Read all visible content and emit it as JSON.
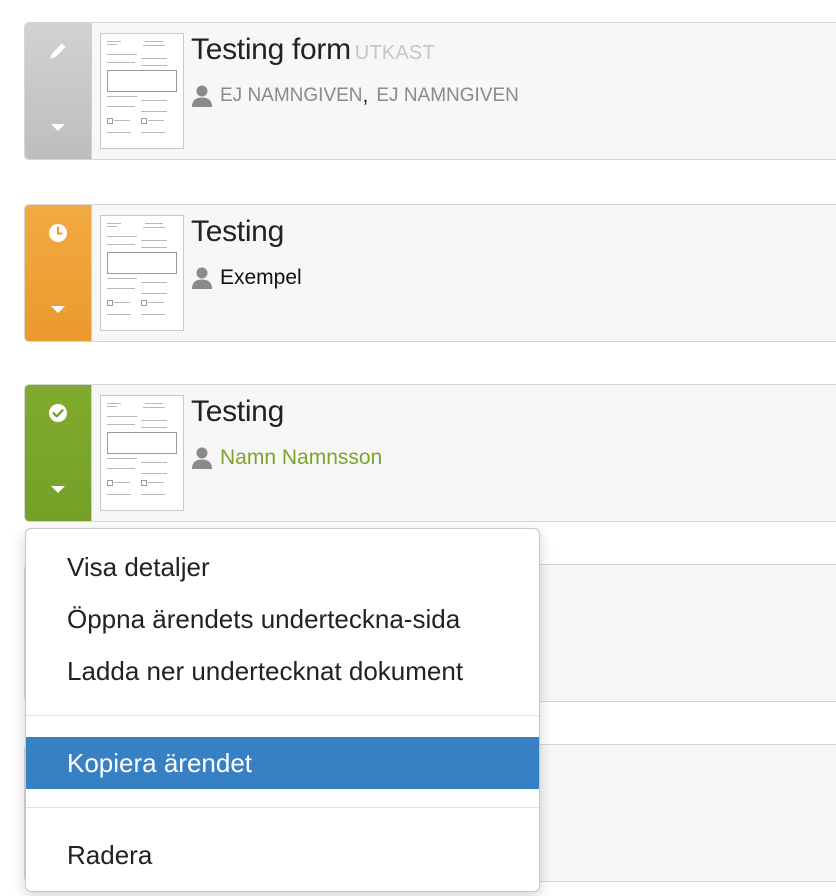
{
  "cases": [
    {
      "title": "Testing form",
      "badge": "UTKAST",
      "status": "draft",
      "status_color": "#c4c4c4",
      "status_icon": "pencil-icon",
      "signers": [
        "EJ NAMNGIVEN",
        "EJ NAMNGIVEN"
      ],
      "signer_separator": ","
    },
    {
      "title": "Testing",
      "status": "pending",
      "status_color": "#f0a437",
      "status_icon": "clock-icon",
      "signers": [
        "Exempel"
      ]
    },
    {
      "title": "Testing",
      "status": "signed",
      "status_color": "#7aa42a",
      "status_icon": "check-circle-icon",
      "signers": [
        "Namn Namnsson"
      ],
      "signer_color": "#7aa42a"
    }
  ],
  "context_menu": {
    "items": [
      {
        "label": "Visa detaljer"
      },
      {
        "label": "Öppna ärendets underteckna-sida"
      },
      {
        "label": "Ladda ner undertecknat dokument"
      },
      {
        "label": "Kopiera ärendet",
        "highlighted": true
      },
      {
        "label": "Radera"
      }
    ],
    "highlight_color": "#3880c4"
  }
}
